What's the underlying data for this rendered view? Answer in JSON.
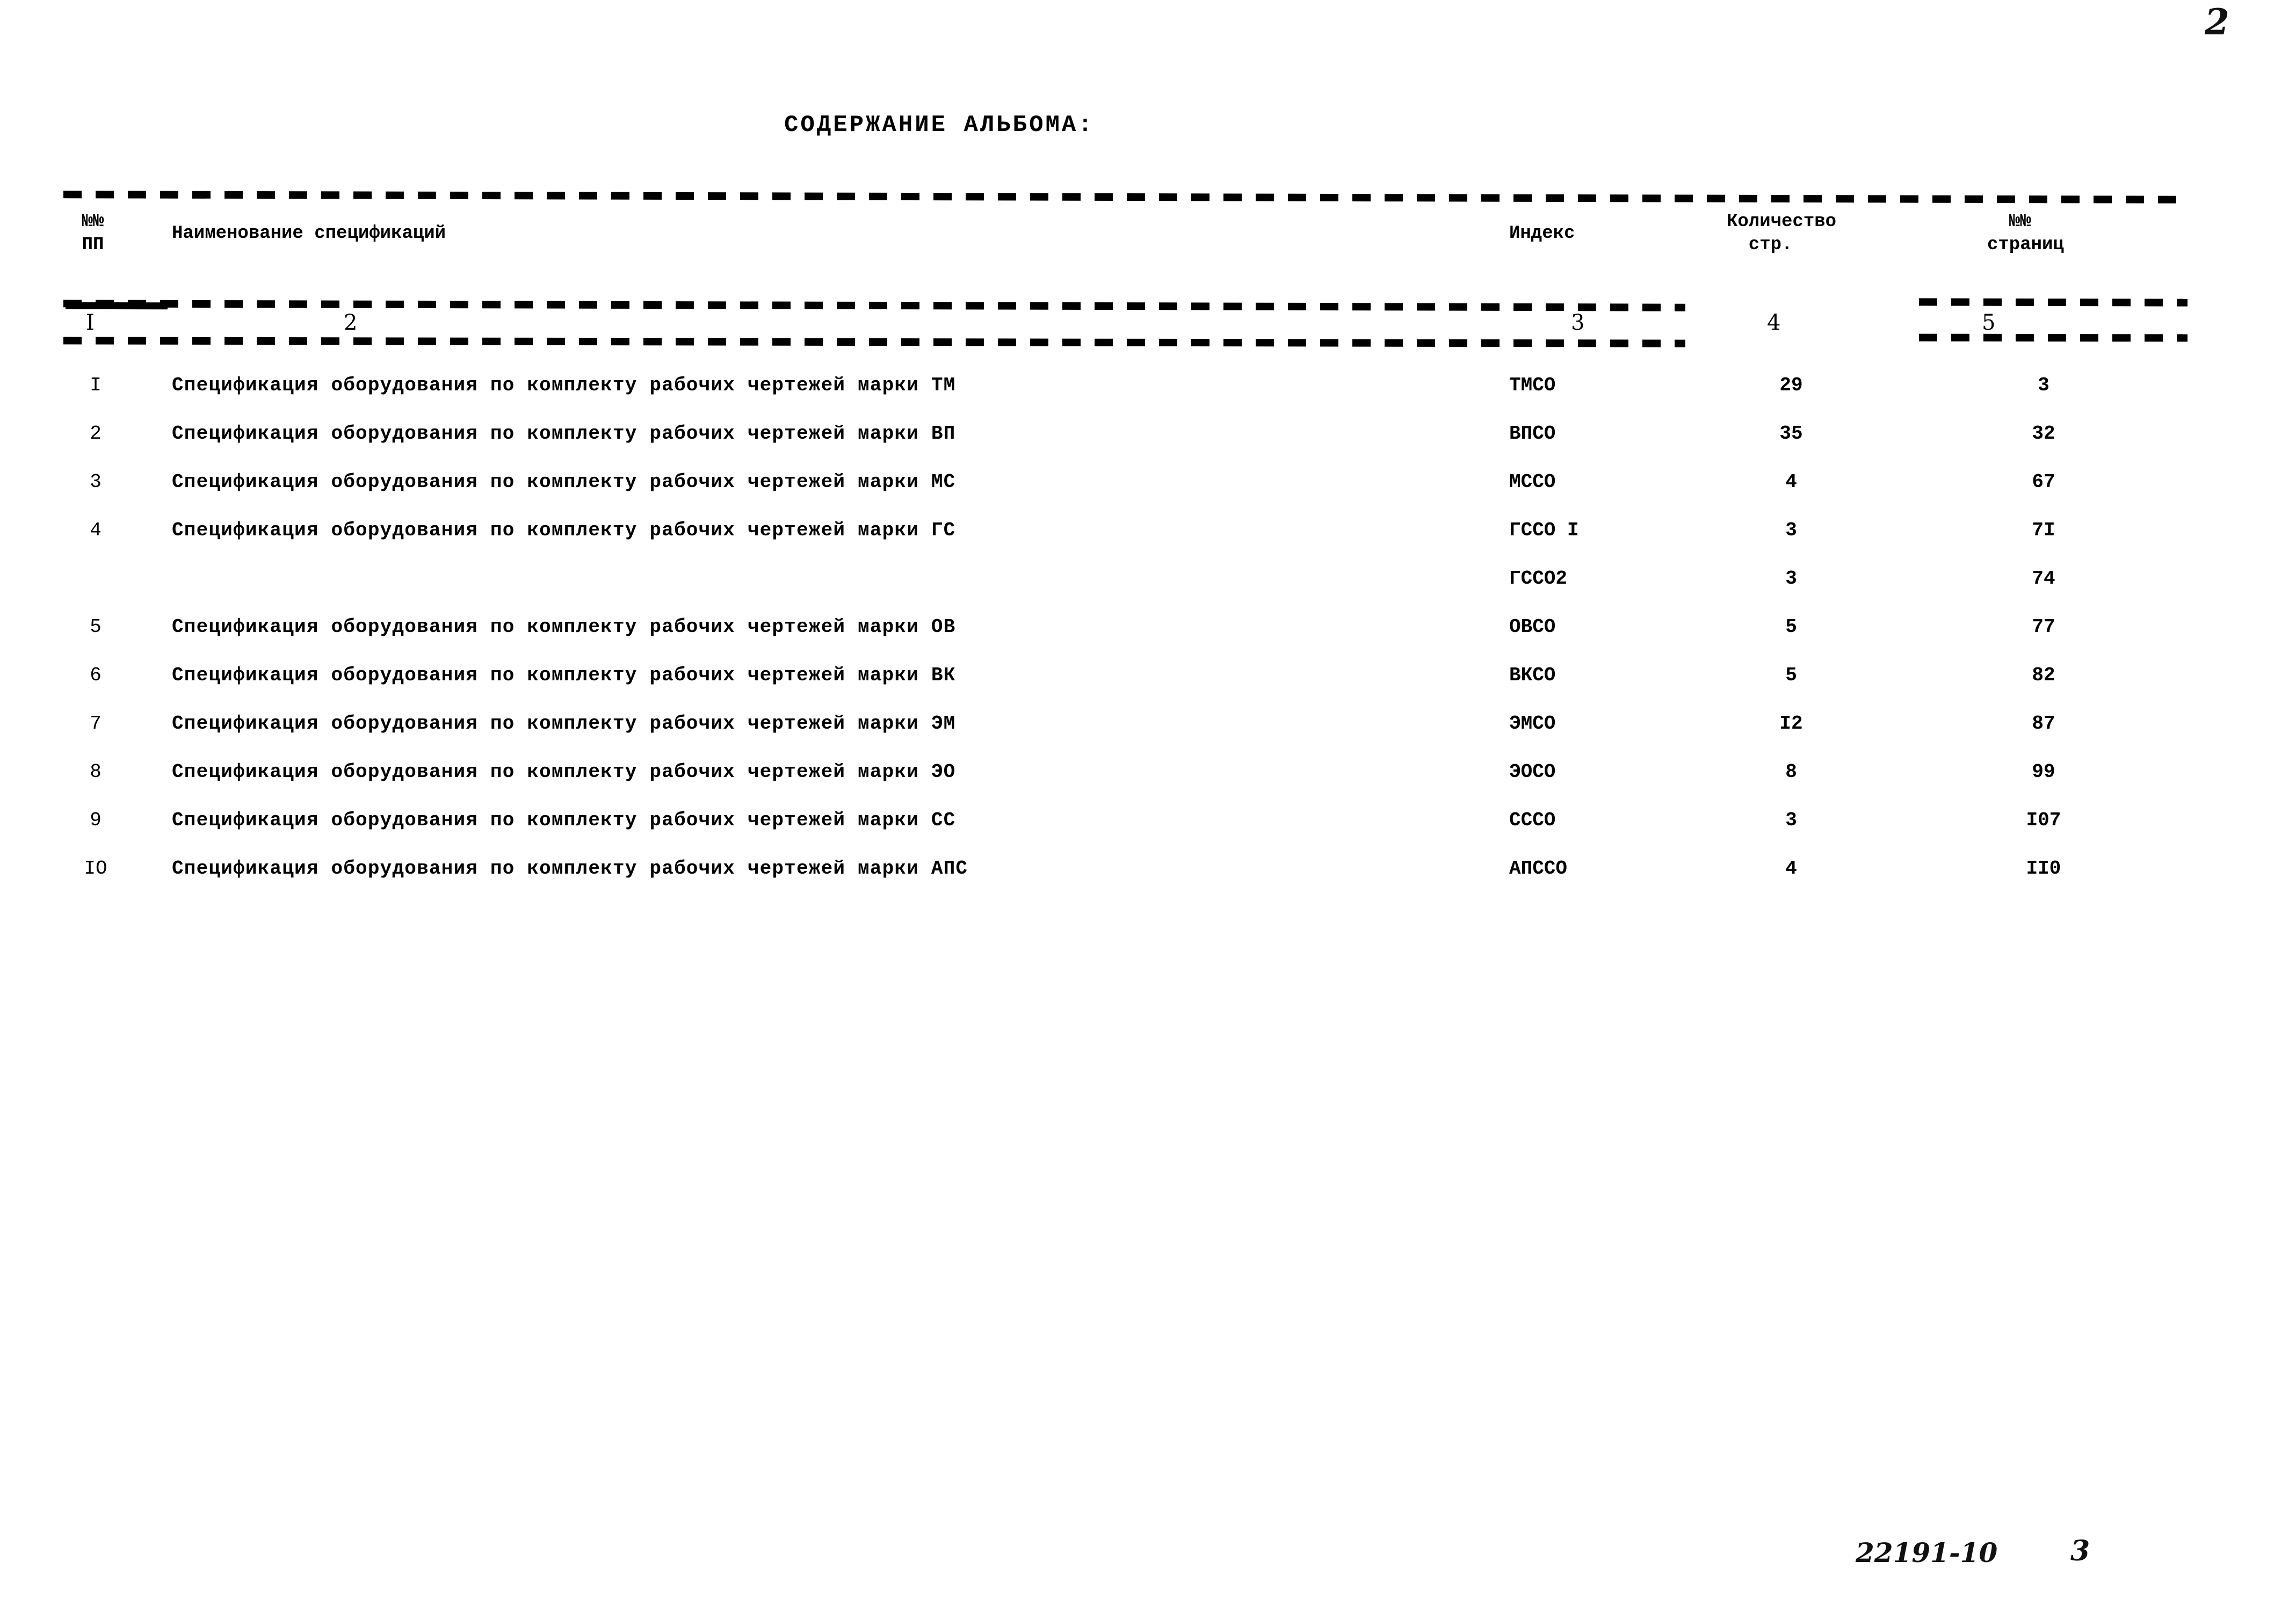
{
  "page": {
    "page_number_top": "2",
    "title": "СОДЕРЖАНИЕ АЛЬБОМА:"
  },
  "table": {
    "headers": {
      "pp": "№№\nПП",
      "name": "Наименование спецификаций",
      "index": "Индекс",
      "count": "Количество\n  стр.",
      "pages": "  №№\nстраниц"
    },
    "column_numbers": [
      "I",
      "2",
      "3",
      "4",
      "5"
    ],
    "rows": [
      {
        "num": "I",
        "name": "Спецификация оборудования по комплекту рабочих чертежей марки ТМ",
        "index": "ТМСО",
        "count": "29",
        "pages": "3"
      },
      {
        "num": "2",
        "name": "Спецификация оборудования по комплекту рабочих чертежей марки ВП",
        "index": "ВПСО",
        "count": "35",
        "pages": "32"
      },
      {
        "num": "3",
        "name": "Спецификация оборудования по комплекту рабочих чертежей марки МС",
        "index": "МССО",
        "count": "4",
        "pages": "67"
      },
      {
        "num": "4",
        "name": "Спецификация оборудования по комплекту рабочих чертежей марки ГС",
        "index": "ГССО I",
        "count": "3",
        "pages": "7I"
      },
      {
        "num": "",
        "name": "",
        "index": "ГССО2",
        "count": "3",
        "pages": "74"
      },
      {
        "num": "5",
        "name": "Спецификация оборудования по комплекту рабочих чертежей марки ОВ",
        "index": "ОВСО",
        "count": "5",
        "pages": "77"
      },
      {
        "num": "6",
        "name": "Спецификация оборудования по комплекту рабочих чертежей марки ВК",
        "index": "ВКСО",
        "count": "5",
        "pages": "82"
      },
      {
        "num": "7",
        "name": "Спецификация оборудования по комплекту рабочих чертежей марки ЭМ",
        "index": "ЭМСО",
        "count": "I2",
        "pages": "87"
      },
      {
        "num": "8",
        "name": "Спецификация оборудования по комплекту рабочих чертежей марки ЭО",
        "index": "ЭОСО",
        "count": "8",
        "pages": "99"
      },
      {
        "num": "9",
        "name": "Спецификация оборудования по комплекту рабочих чертежей марки СС",
        "index": "СССО",
        "count": "3",
        "pages": "I07"
      },
      {
        "num": "IO",
        "name": "Спецификация оборудования по комплекту рабочих чертежей марки АПС",
        "index": "АПССО",
        "count": "4",
        "pages": "II0"
      }
    ]
  },
  "footer": {
    "code": "22191-10",
    "page": "3"
  },
  "colors": {
    "ink": "#000000",
    "paper": "#ffffff"
  }
}
